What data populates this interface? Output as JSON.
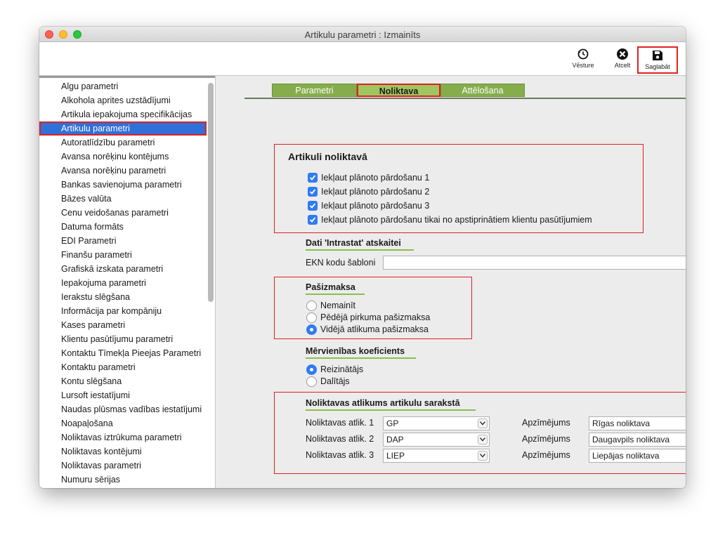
{
  "window": {
    "title": "Artikulu parametri : Izmainīts"
  },
  "toolbar": {
    "history_label": "Vēsture",
    "cancel_label": "Atcelt",
    "save_label": "Saglabāt"
  },
  "sidebar": {
    "items": [
      "Algu parametri",
      "Alkohola aprites uzstādījumi",
      "Artikula iepakojuma specifikācijas",
      "Artikulu parametri",
      "Autoratlīdzību parametri",
      "Avansa norēķinu kontējums",
      "Avansa norēķinu parametri",
      "Bankas savienojuma parametri",
      "Bāzes valūta",
      "Cenu veidošanas parametri",
      "Datuma formāts",
      "EDI Parametri",
      "Finanšu parametri",
      "Grafiskā izskata parametri",
      "Iepakojuma parametri",
      "Ierakstu slēgšana",
      "Informācija par kompāniju",
      "Kases parametri",
      "Klientu pasūtījumu parametri",
      "Kontaktu Tīmekļa Pieejas Parametri",
      "Kontaktu parametri",
      "Kontu slēgšana",
      "Lursoft iestatījumi",
      "Naudas plūsmas vadības iestatījumi",
      "Noapaļošana",
      "Noliktavas iztrūkuma parametri",
      "Noliktavas kontējumi",
      "Noliktavas parametri",
      "Numuru sērijas"
    ],
    "active": "Artikulu parametri"
  },
  "tabs": {
    "t1": "Parametri",
    "t2": "Noliktava",
    "t3": "Attēlošana"
  },
  "stock": {
    "title": "Artikuli noliktavā",
    "checks": [
      "Iekļaut plānoto pārdošanu 1",
      "Iekļaut plānoto pārdošanu 2",
      "Iekļaut plānoto pārdošanu 3",
      "Iekļaut plānoto pārdošanu tikai no apstiprinātiem klientu pasūtījumiem"
    ]
  },
  "intrastat": {
    "title": "Dati 'Intrastat' atskaitei",
    "ekn_label": "EKN kodu šabloni",
    "ekn_value": ""
  },
  "cost": {
    "title": "Pašizmaksa",
    "options": [
      "Nemainīt",
      "Pēdējā pirkuma pašizmaksa",
      "Vidējā atlikuma pašizmaksa"
    ],
    "selected": "Vidējā atlikuma pašizmaksa"
  },
  "unit": {
    "title": "Mērvienības koeficients",
    "options": [
      "Reizinātājs",
      "Dalītājs"
    ],
    "selected": "Reizinātājs"
  },
  "balance": {
    "title": "Noliktavas atlikums artikulu sarakstā",
    "rows": [
      {
        "label": "Noliktavas atlik. 1",
        "value": "GP",
        "desc_label": "Apzīmējums",
        "desc": "Rīgas noliktava"
      },
      {
        "label": "Noliktavas atlik. 2",
        "value": "DAP",
        "desc_label": "Apzīmējums",
        "desc": "Daugavpils noliktava"
      },
      {
        "label": "Noliktavas atlik. 3",
        "value": "LIEP",
        "desc_label": "Apzīmējums",
        "desc": "Liepājas noliktava"
      }
    ]
  },
  "colors": {
    "accent": "#2f7bf2",
    "tab": "#86ad4c",
    "highlight": "#e02020",
    "selection": "#3070d8"
  }
}
